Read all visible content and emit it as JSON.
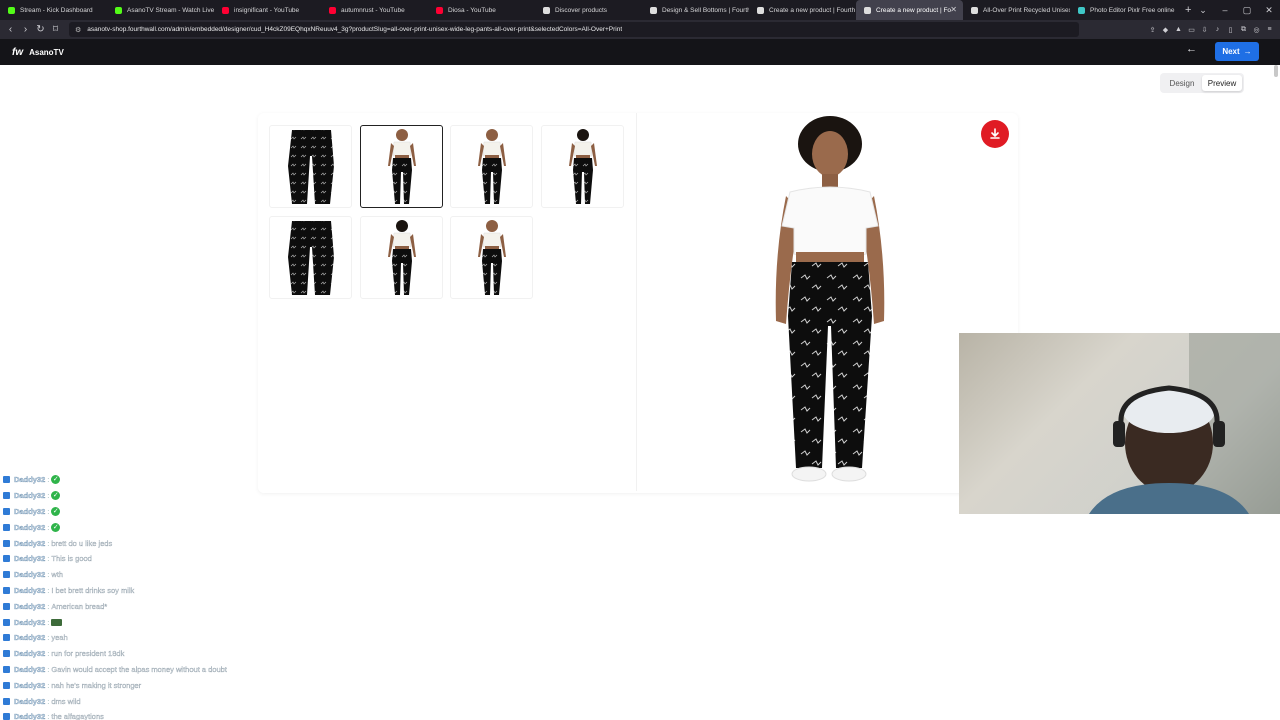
{
  "browser": {
    "tabs": [
      {
        "label": "Stream - Kick Dashboard",
        "color": "#53fc18"
      },
      {
        "label": "AsanoTV Stream - Watch Live",
        "color": "#53fc18"
      },
      {
        "label": "insignificant - YouTube",
        "color": "#ff0033"
      },
      {
        "label": "autumnrust - YouTube",
        "color": "#ff0033"
      },
      {
        "label": "Diosa - YouTube",
        "color": "#ff0033"
      },
      {
        "label": "Discover products",
        "color": "#dddddd"
      },
      {
        "label": "Design & Sell Bottoms | Fourth",
        "color": "#dddddd"
      },
      {
        "label": "Create a new product | Fourth",
        "color": "#dddddd"
      },
      {
        "label": "Create a new product | Fo",
        "color": "#dddddd",
        "active": true
      },
      {
        "label": "All-Over Print Recycled Unisex",
        "color": "#dddddd"
      },
      {
        "label": "Photo Editor Pixlr Free online",
        "color": "#3fc7c7"
      }
    ],
    "url": "asanotv-shop.fourthwall.com/admin/embedded/designer/cud_H4ckZ09EQhqxNReuuv4_3g?productSlug=all-over-print-unisex-wide-leg-pants-all-over-print&selectedColors=All-Over+Print"
  },
  "app": {
    "logo": "fw",
    "brand": "AsanoTV",
    "next_label": "Next",
    "mode_tabs": [
      {
        "label": "Design",
        "active": false
      },
      {
        "label": "Preview",
        "active": true
      }
    ]
  },
  "chat": {
    "messages": [
      {
        "user": "Daddy32",
        "msg": "",
        "emote": "check"
      },
      {
        "user": "Daddy32",
        "msg": "",
        "emote": "check"
      },
      {
        "user": "Daddy32",
        "msg": "",
        "emote": "check"
      },
      {
        "user": "Daddy32",
        "msg": "",
        "emote": "check"
      },
      {
        "user": "Daddy32",
        "msg": "brett do u like jeds",
        "emote": ""
      },
      {
        "user": "Daddy32",
        "msg": "This is good",
        "emote": ""
      },
      {
        "user": "Daddy32",
        "msg": "wth",
        "emote": ""
      },
      {
        "user": "Daddy32",
        "msg": "I bet brett drinks soy milk",
        "emote": ""
      },
      {
        "user": "Daddy32",
        "msg": "American bread*",
        "emote": ""
      },
      {
        "user": "Daddy32",
        "msg": "",
        "emote": "image"
      },
      {
        "user": "Daddy32",
        "msg": "yeah",
        "emote": ""
      },
      {
        "user": "Daddy32",
        "msg": "run for president 18dk",
        "emote": ""
      },
      {
        "user": "Daddy32",
        "msg": "Gavin would accept the alpas money without a doubt",
        "emote": ""
      },
      {
        "user": "Daddy32",
        "msg": "nah he's making it stronger",
        "emote": ""
      },
      {
        "user": "Daddy32",
        "msg": "dms wild",
        "emote": ""
      },
      {
        "user": "Daddy32",
        "msg": "the alfagaytions",
        "emote": ""
      }
    ]
  },
  "colors": {
    "accent": "#1f6fe5",
    "download": "#e01b24",
    "pants": "#0d0d0d"
  }
}
